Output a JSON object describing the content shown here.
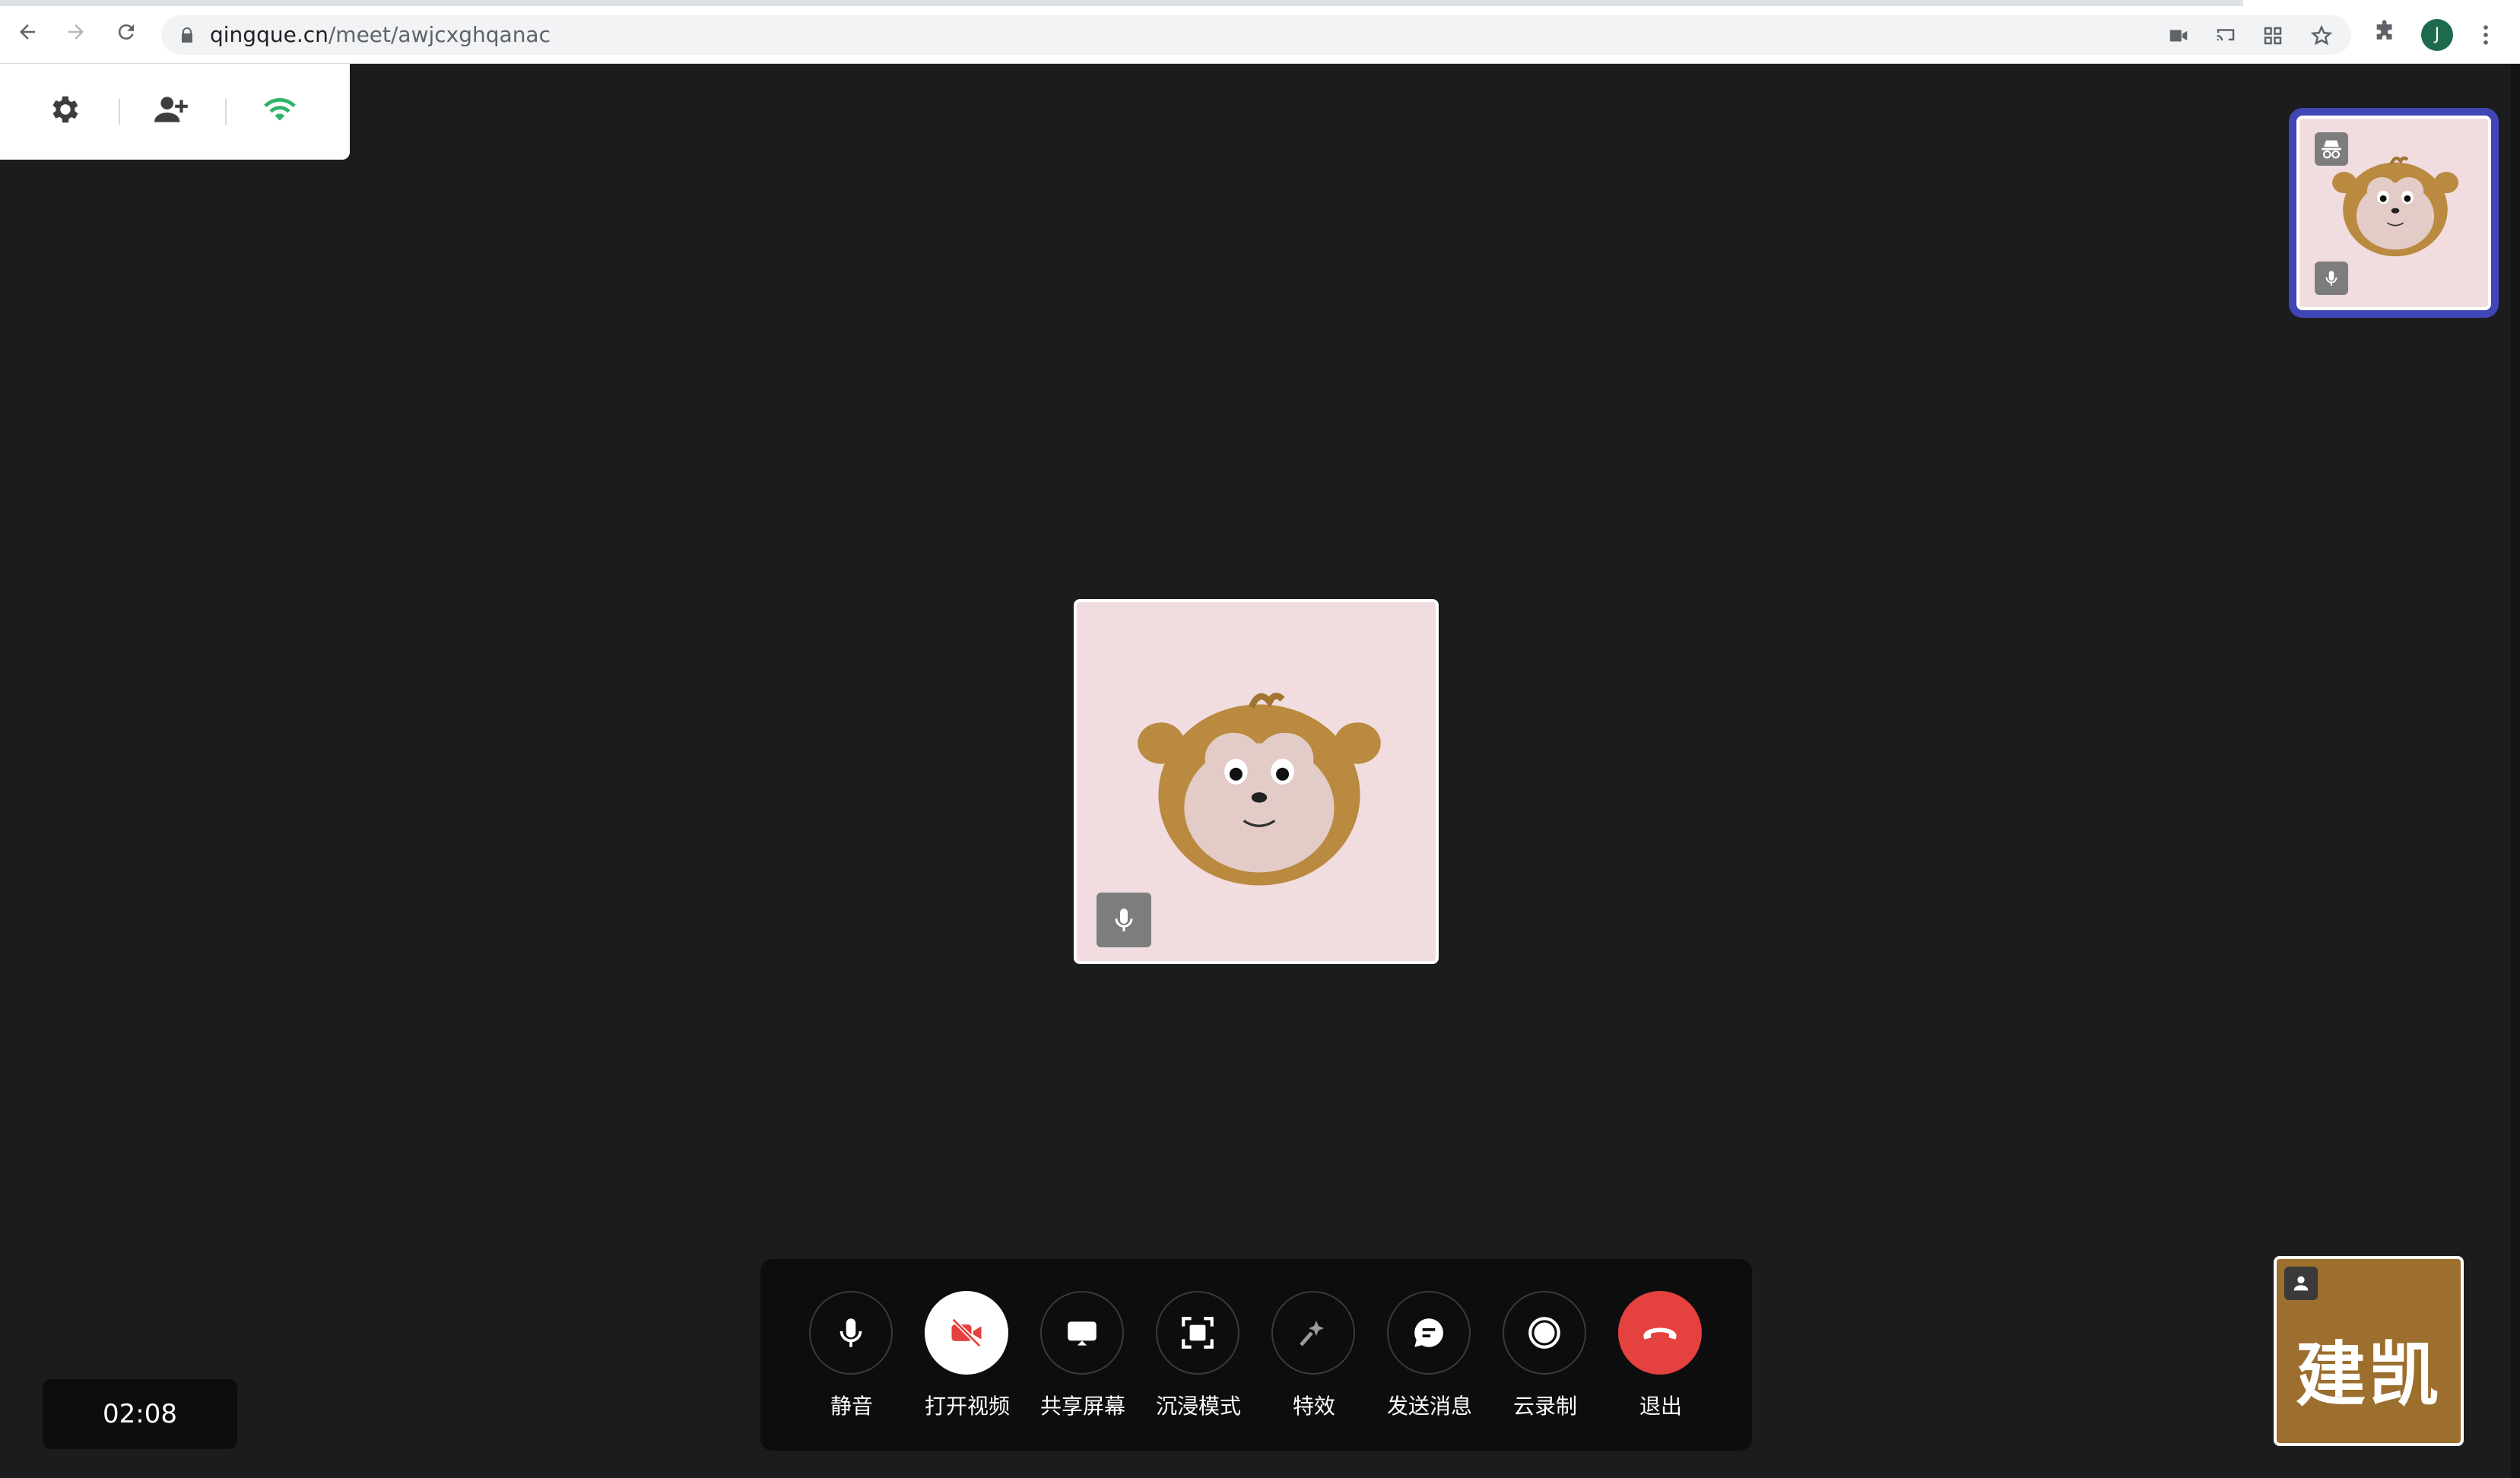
{
  "browser": {
    "url_host": "qingque.cn",
    "url_path": "/meet/awjcxghqanac",
    "profile_initial": "J"
  },
  "toolbar_top": {
    "settings_icon": "gear-icon",
    "invite_icon": "person-add-icon",
    "network_icon": "wifi-icon"
  },
  "colors": {
    "background": "#1b1c1e",
    "tile_bg": "#f1dde0",
    "active_speaker_border": "#4046b5",
    "name_tile_bg": "#9c6f2e",
    "hangup_red": "#e5413f",
    "video_off_red": "#e5413f",
    "network_green": "#2db46a"
  },
  "name_tile": {
    "name": "建凯"
  },
  "timer": {
    "elapsed": "02:08"
  },
  "controls": [
    {
      "label": "静音",
      "icon": "microphone-icon"
    },
    {
      "label": "打开视频",
      "icon": "video-off-icon"
    },
    {
      "label": "共享屏幕",
      "icon": "screen-share-icon"
    },
    {
      "label": "沉浸模式",
      "icon": "immersive-mode-icon"
    },
    {
      "label": "特效",
      "icon": "effects-wand-icon"
    },
    {
      "label": "发送消息",
      "icon": "chat-bubble-icon"
    },
    {
      "label": "云录制",
      "icon": "record-icon"
    },
    {
      "label": "退出",
      "icon": "hang-up-icon"
    }
  ]
}
